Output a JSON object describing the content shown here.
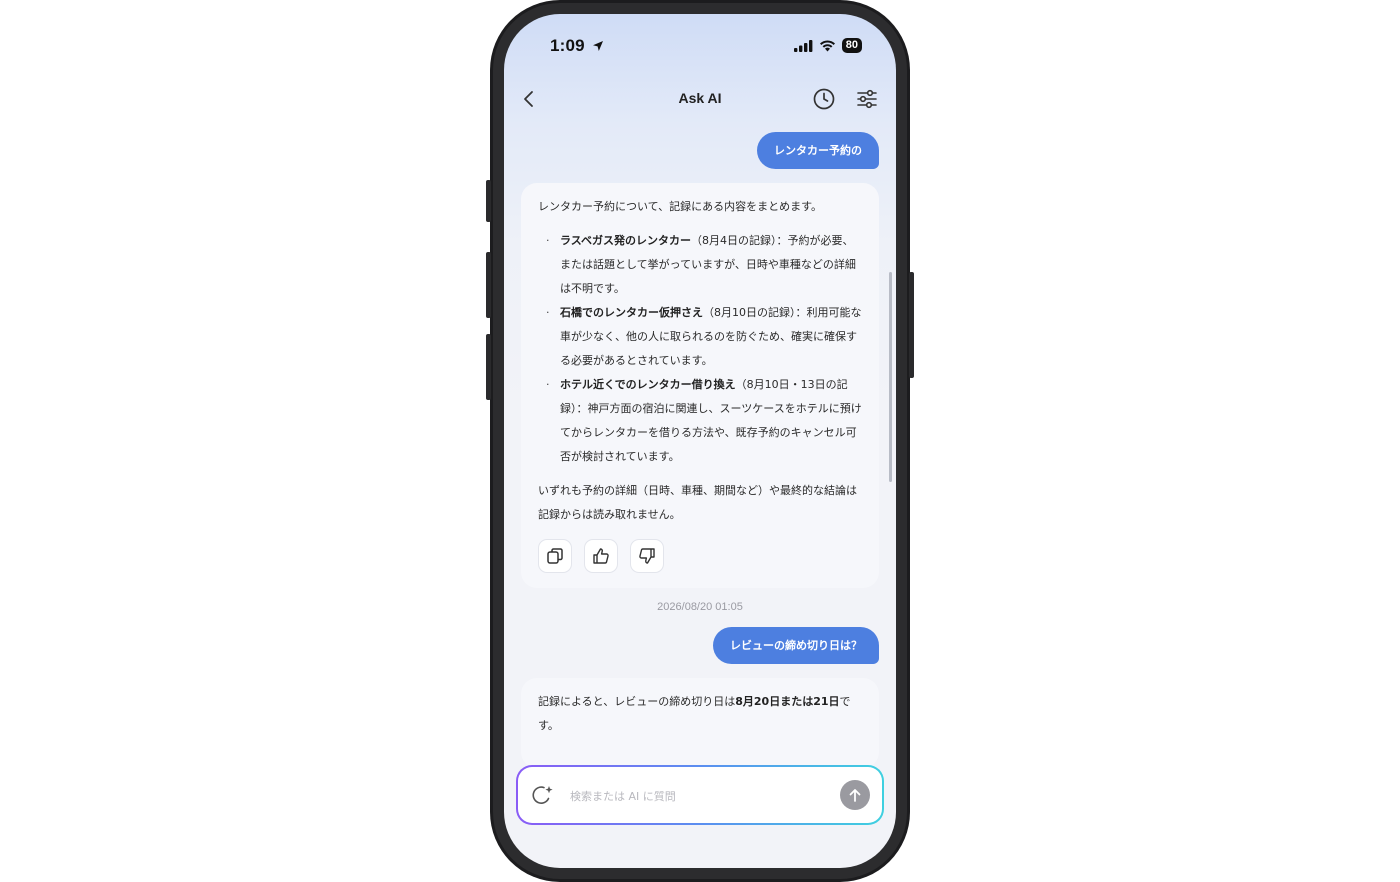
{
  "status_bar": {
    "time": "1:09",
    "battery": "80"
  },
  "nav": {
    "title": "Ask AI"
  },
  "messages": {
    "user1": "レンタカー予約の",
    "ai1": {
      "intro": "レンタカー予約について、記録にある内容をまとめます。",
      "items": [
        {
          "bold": "ラスベガス発のレンタカー",
          "text": "（8月4日の記録）：予約が必要、または話題として挙がっていますが、日時や車種などの詳細は不明です。"
        },
        {
          "bold": "石橋でのレンタカー仮押さえ",
          "text": "（8月10日の記録）：利用可能な車が少なく、他の人に取られるのを防ぐため、確実に確保する必要があるとされています。"
        },
        {
          "bold": "ホテル近くでのレンタカー借り換え",
          "text": "（8月10日・13日の記録）：神戸方面の宿泊に関連し、スーツケースをホテルに預けてからレンタカーを借りる方法や、既存予約のキャンセル可否が検討されています。"
        }
      ],
      "outro": "いずれも予約の詳細（日時、車種、期間など）や最終的な結論は記録からは読み取れません。"
    },
    "timestamp": "2026/08/20 01:05",
    "user2": "レビューの締め切り日は？",
    "ai2": {
      "prefix": "記録によると、レビューの締め切り日は",
      "bold": "8月20日または21日",
      "suffix": "です。"
    }
  },
  "input": {
    "placeholder": "検索または AI に質問",
    "value": ""
  },
  "icons": {
    "back": "chevron-left-icon",
    "history": "clock-icon",
    "settings": "sliders-icon",
    "copy": "copy-icon",
    "like": "thumbs-up-icon",
    "dislike": "thumbs-down-icon",
    "sparkle": "sparkle-icon",
    "send": "arrow-up-icon"
  },
  "colors": {
    "accent": "#4d7fe0",
    "send_disabled": "#9a9aa0"
  }
}
